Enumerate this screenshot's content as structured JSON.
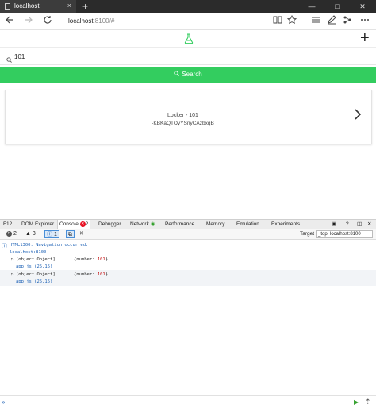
{
  "browser": {
    "tab_title": "localhost",
    "tab_close": "×",
    "new_tab": "+",
    "window_buttons": [
      "—",
      "□",
      "✕"
    ],
    "address_host": "localhost",
    "address_path": ":8100/#"
  },
  "app": {
    "add_button": "+",
    "search": {
      "value": "101",
      "placeholder": ""
    },
    "search_button_label": "Search",
    "card": {
      "title": "Locker - 101",
      "subtitle": "-KBKaQTOyYSnyCAzbxqB"
    },
    "accent_color": "#33cd5f"
  },
  "devtools": {
    "f12_label": "F12",
    "tabs": [
      "DOM Explorer",
      "Console",
      "Debugger",
      "Network",
      "Performance",
      "Memory",
      "Emulation",
      "Experiments"
    ],
    "console_error_count": "2",
    "filters": {
      "errors": "2",
      "warnings": "3",
      "messages": "1"
    },
    "target_label": "Target",
    "target_value": "_top: localhost:8100",
    "entries": [
      {
        "text": "HTML1300: Navigation occurred.",
        "source": "localhost:8100"
      },
      {
        "object": "[object Object]",
        "value_prefix": "{number: ",
        "value_num": "101",
        "value_suffix": "}",
        "source": "app.js (25,15)"
      },
      {
        "object": "[object Object]",
        "value_prefix": "{number: ",
        "value_num": "101",
        "value_suffix": "}",
        "source": "app.js (25,15)"
      }
    ]
  }
}
